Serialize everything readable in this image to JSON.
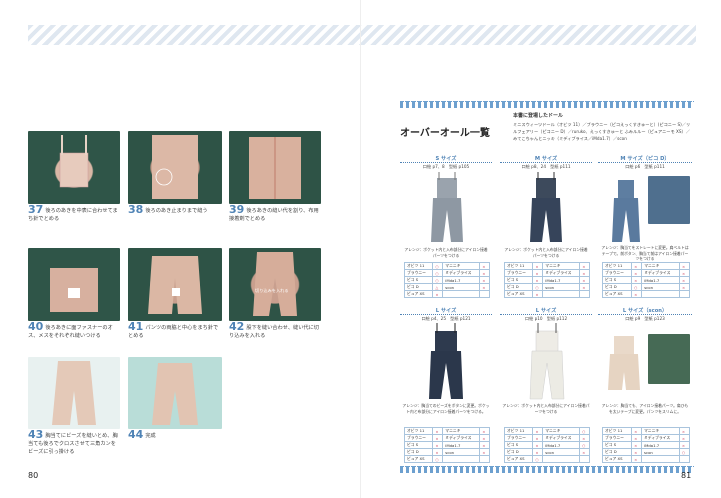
{
  "left_page": {
    "steps": [
      {
        "num": "37",
        "text": "後ろのあきを中表に合わせてまち針でとめる"
      },
      {
        "num": "38",
        "text": "後ろのあき止まりまで縫う"
      },
      {
        "num": "39",
        "text": "後ろあきの縫い代を割り、布用接着剤でとめる"
      },
      {
        "num": "40",
        "text": "後ろあきに面ファスナーのオス、メスをそれぞれ縫いつける"
      },
      {
        "num": "41",
        "text": "パンツの両脇と中心をまち針でとめる"
      },
      {
        "num": "42",
        "text": "股下を縫い合わせ、縫い代に切り込みを入れる"
      },
      {
        "num": "43",
        "text": "胸当てにビーズを縫いとめ、胸当ても後ろでクロスさせて三角カンをビーズに引っ掛ける"
      },
      {
        "num": "44",
        "text": "完成"
      }
    ],
    "photo_annotations": {
      "step38": "あき止まり",
      "step40_a": "オス",
      "step40_b": "メス",
      "step42": "切り込みを入れる"
    },
    "page_number": "80"
  },
  "right_page": {
    "title": "オーバーオール一覧",
    "dolls_heading": "本書に登場したドール",
    "dolls_list": "ミニスウィーツドール（オビツ 11）／ブラウニー（ピコえっくすきゅーと）(ピコニー S)／リルフェアリー（ピコニー D）／ruruko、えっくすきゅーと ふみルルー（ピュアニーモ XS）／みてこちゃんとニッキ（ミディブライス／iMda1.7）／scon",
    "groups": [
      {
        "size": "S サイズ",
        "info": "口絵 p7、8　型紙 p105",
        "note": "アレンジ：ポケット内と入布部分にアイロン接着パーツをつける",
        "fits": [
          [
            "オビツ 11",
            "○",
            "マニニキ",
            "×"
          ],
          [
            "ブラウニー",
            "○",
            "ミディブライス",
            "×"
          ],
          [
            "ピコ S",
            "○",
            "iMda1.7",
            "×"
          ],
          [
            "ピコ D",
            "△",
            "scon",
            "×"
          ],
          [
            "ピュア XS",
            "×",
            "",
            ""
          ]
        ]
      },
      {
        "size": "M サイズ",
        "info": "口絵 p8、24　型紙 p111",
        "note": "アレンジ：ポケット内と入布部分にアイロン接着パーツをつける",
        "fits": [
          [
            "オビツ 11",
            "×",
            "マニニキ",
            "×"
          ],
          [
            "ブラウニー",
            "×",
            "ミディブライス",
            "×"
          ],
          [
            "ピコ S",
            "×",
            "iMda1.7",
            "×"
          ],
          [
            "ピコ D",
            "○",
            "scon",
            "×"
          ],
          [
            "ピュア XS",
            "×",
            "",
            ""
          ]
        ]
      },
      {
        "size": "M サイズ（ピコ D）",
        "info": "口絵 p6　型紙 p111",
        "note": "アレンジ：胸当てをストレートに変更。肩ベルトはテープで。前ボタン、胸当て前はアイロン接着パーツをつける",
        "fits": [
          [
            "オビツ 11",
            "×",
            "マニニキ",
            "×"
          ],
          [
            "ブラウニー",
            "×",
            "ミディブライス",
            "×"
          ],
          [
            "ピコ S",
            "×",
            "iMda1.7",
            "×"
          ],
          [
            "ピコ D",
            "○",
            "scon",
            "×"
          ],
          [
            "ピュア XS",
            "×",
            "",
            ""
          ]
        ]
      },
      {
        "size": "L サイズ",
        "info": "口絵 p4、25　型紙 p121",
        "note": "アレンジ：胸当てのビーズをボタンに変更。ポケット内と布部分にアイロン接着パーツをつける。",
        "fits": [
          [
            "オビツ 11",
            "×",
            "マニニキ",
            "×"
          ],
          [
            "ブラウニー",
            "×",
            "ミディブライス",
            "×"
          ],
          [
            "ピコ S",
            "×",
            "iMda1.7",
            "×"
          ],
          [
            "ピコ D",
            "×",
            "scon",
            "×"
          ],
          [
            "ピュア XS",
            "○",
            "",
            ""
          ]
        ]
      },
      {
        "size": "L サイズ",
        "info": "口絵 p10　型紙 p112",
        "note": "アレンジ：ポケット内と入布部分にアイロン接着パーツをつける",
        "fits": [
          [
            "オビツ 11",
            "×",
            "マニニキ",
            "○"
          ],
          [
            "ブラウニー",
            "×",
            "ミディブライス",
            "×"
          ],
          [
            "ピコ S",
            "×",
            "iMda1.7",
            "○"
          ],
          [
            "ピコ D",
            "×",
            "scon",
            "×"
          ],
          [
            "ピュア XS",
            "○",
            "",
            ""
          ]
        ]
      },
      {
        "size": "L サイズ（scon）",
        "info": "口絵 p9　型紙 p123",
        "note": "アレンジ：胸当ても、アイロン接着パーツ。肩ひもを太いテープに変更。パンツをスリムに。",
        "fits": [
          [
            "オビツ 11",
            "×",
            "マニニキ",
            "×"
          ],
          [
            "ブラウニー",
            "×",
            "ミディブライス",
            "×"
          ],
          [
            "ピコ S",
            "×",
            "iMda1.7",
            "×"
          ],
          [
            "ピコ D",
            "×",
            "scon",
            "○"
          ],
          [
            "ピュア XS",
            "×",
            "",
            ""
          ]
        ]
      }
    ],
    "page_number": "81"
  },
  "colors": {
    "accent": "#4f83b5",
    "stripe": "#dfe7f0",
    "table_border": "#a9c4dd",
    "mark": "#d0506a"
  }
}
